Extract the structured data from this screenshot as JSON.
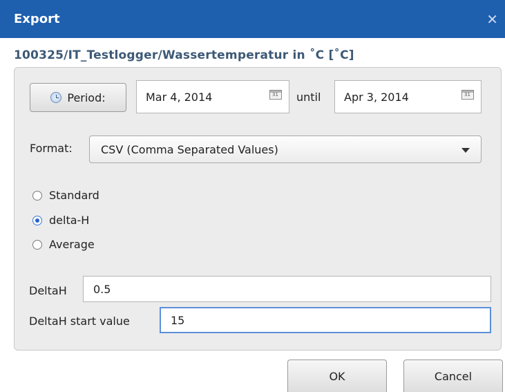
{
  "dialog": {
    "title": "Export",
    "close_glyph": "✕",
    "subtitle": "100325/IT_Testlogger/Wassertemperatur in ˚C [˚C]"
  },
  "period": {
    "button_label": "Period:",
    "from_date": "Mar 4, 2014",
    "until_label": "until",
    "to_date": "Apr 3, 2014",
    "calendar_glyph": "31"
  },
  "format": {
    "label": "Format:",
    "selected": "CSV (Comma Separated Values)"
  },
  "modes": [
    {
      "label": "Standard",
      "checked": false
    },
    {
      "label": "delta-H",
      "checked": true
    },
    {
      "label": "Average",
      "checked": false
    }
  ],
  "deltah": {
    "label": "DeltaH",
    "value": "0.5",
    "start_label": "DeltaH start value",
    "start_value": "15"
  },
  "buttons": {
    "ok": "OK",
    "cancel": "Cancel"
  },
  "colors": {
    "titlebar": "#1e5fae",
    "subtitle": "#3d5976",
    "focus": "#5b8fd9"
  }
}
